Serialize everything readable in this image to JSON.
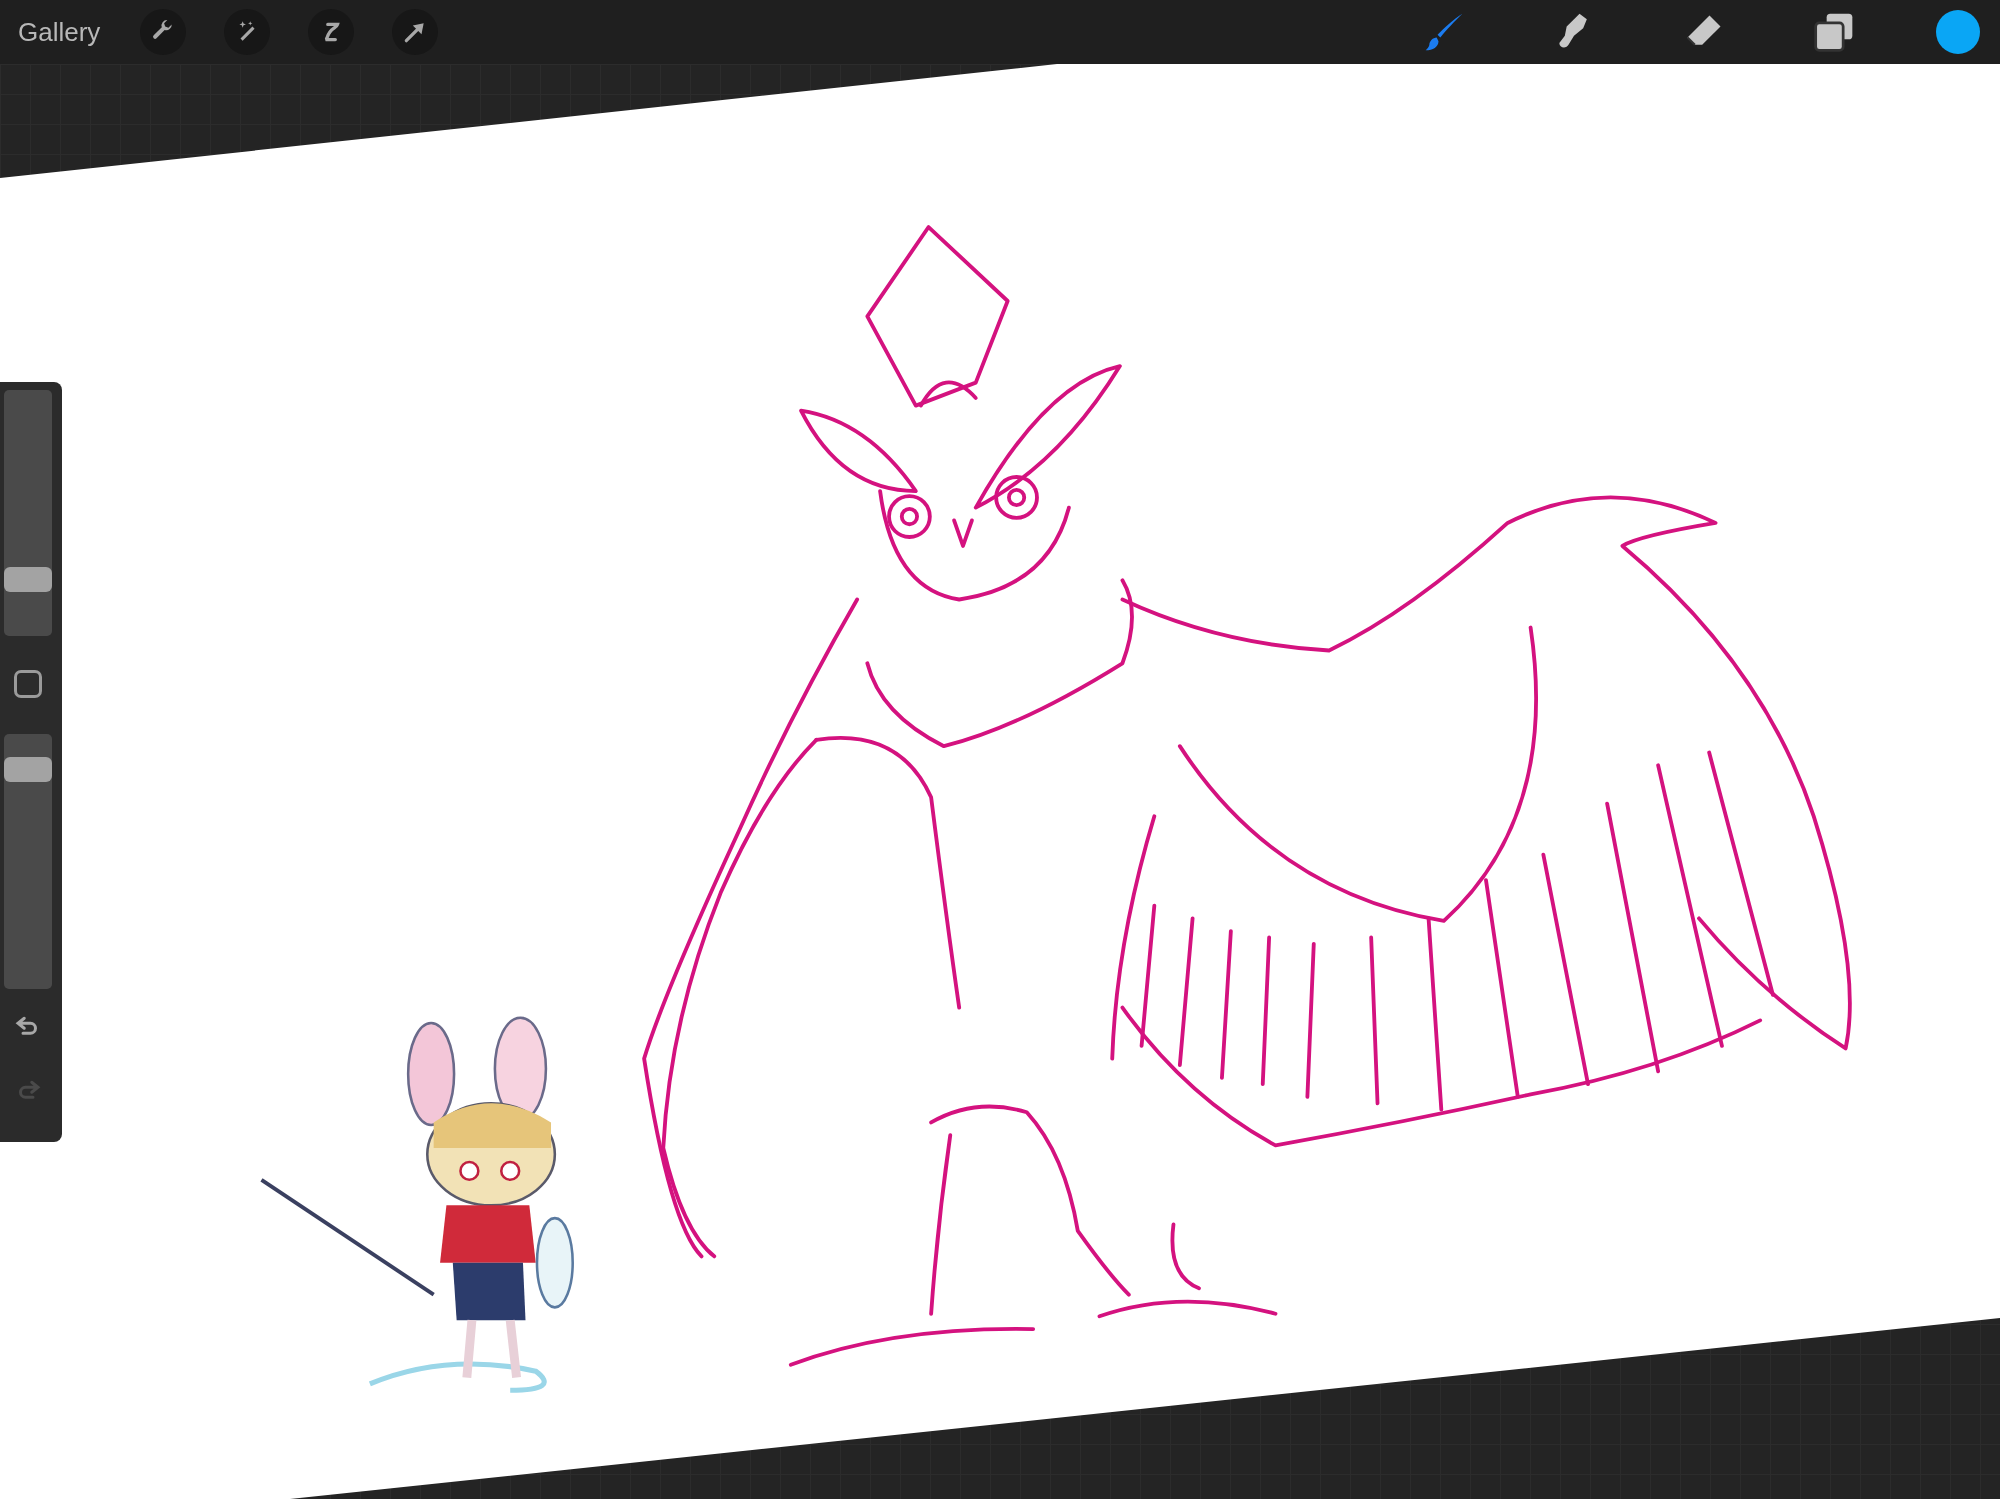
{
  "toolbar": {
    "gallery_label": "Gallery",
    "tools": [
      {
        "kind": "paint",
        "selected": true
      },
      {
        "kind": "smudge",
        "selected": false
      },
      {
        "kind": "erase",
        "selected": false
      },
      {
        "kind": "layers",
        "selected": false
      }
    ],
    "color": "#0aa6f5"
  },
  "sidebar": {
    "brush_size": {
      "level": 0.2
    },
    "opacity": {
      "level": 0.9
    },
    "undo": {
      "disabled": false
    },
    "redo": {
      "disabled": true
    }
  }
}
